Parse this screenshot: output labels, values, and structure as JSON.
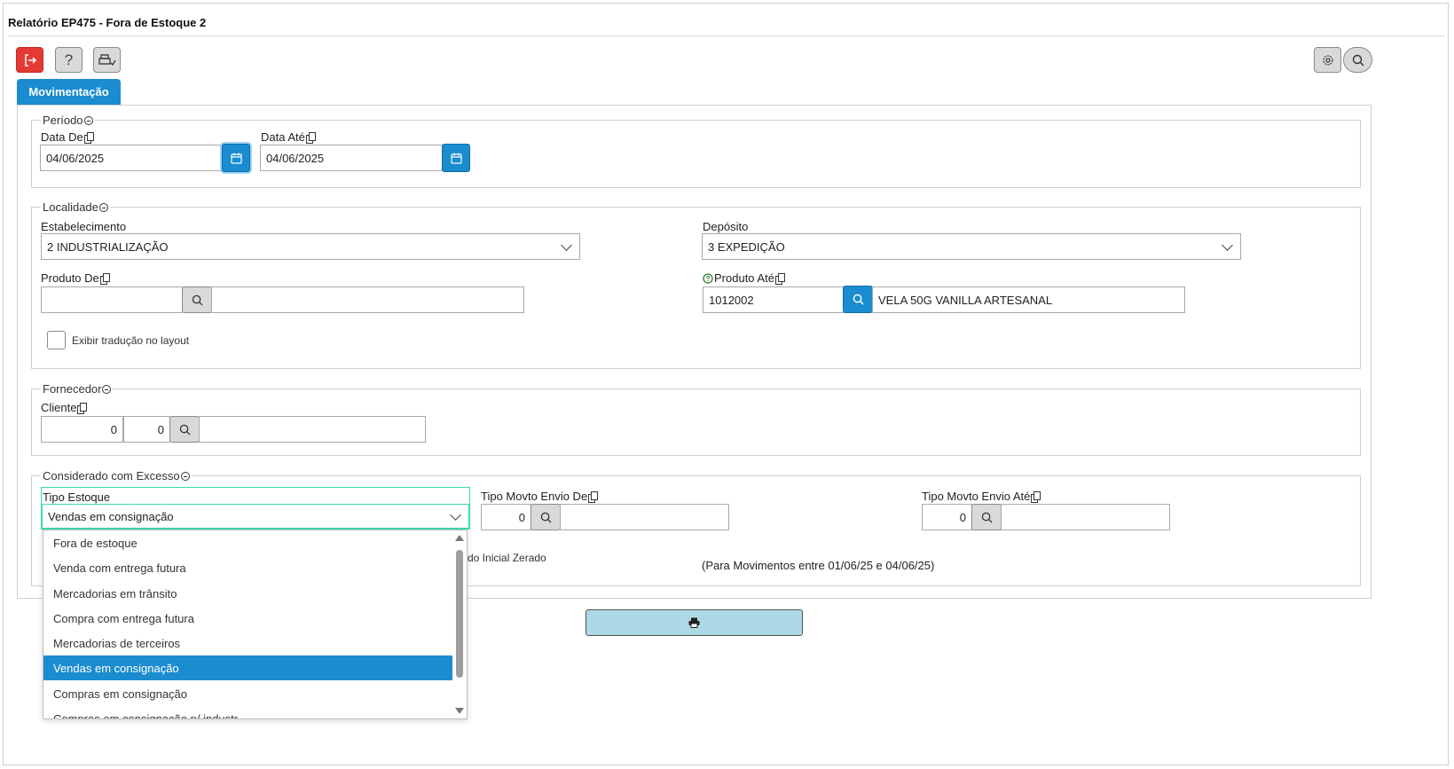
{
  "window": {
    "title": "Relatório EP475 - Fora de Estoque 2"
  },
  "toolbar": {
    "icons": [
      "exit-icon",
      "help-icon",
      "print-setup-icon",
      "gear-icon",
      "search-icon"
    ]
  },
  "tabs": [
    {
      "label": "Movimentação",
      "active": true
    }
  ],
  "periodo": {
    "legend": "Período",
    "data_de": {
      "label": "Data De",
      "value": "04/06/2025"
    },
    "data_ate": {
      "label": "Data Até",
      "value": "04/06/2025"
    }
  },
  "localidade": {
    "legend": "Localidade",
    "estabelecimento": {
      "label": "Estabelecimento",
      "value": "2 INDUSTRIALIZAÇÃO"
    },
    "deposito": {
      "label": "Depósito",
      "value": "3 EXPEDIÇÃO"
    },
    "produto_de": {
      "label": "Produto De",
      "code": "",
      "description": ""
    },
    "produto_ate": {
      "label": "Produto Até",
      "code": "1012002",
      "description": "VELA 50G VANILLA ARTESANAL"
    },
    "exibir_traducao": {
      "label": "Exibir tradução no layout",
      "checked": false
    }
  },
  "fornecedor": {
    "legend": "Fornecedor",
    "cliente": {
      "label": "Cliente",
      "value1": "0",
      "value2": "0",
      "description": ""
    }
  },
  "excesso": {
    "legend": "Considerado com Excesso",
    "tipo_estoque": {
      "label": "Tipo Estoque",
      "value": "Vendas em consignação",
      "options": [
        "Fora de estoque",
        "Venda com entrega futura",
        "Mercadorias em trânsito",
        "Compra com entrega futura",
        "Mercadorias de terceiros",
        "Vendas em consignação",
        "Compras em consignação",
        "Compras em consignação p/ industr"
      ],
      "selected_index": 5
    },
    "tipo_movto_de": {
      "label": "Tipo Movto Envio De",
      "value": "0",
      "description": ""
    },
    "tipo_movto_ate": {
      "label": "Tipo Movto Envio Até",
      "value": "0",
      "description": ""
    },
    "saldo_label_partial": "do Inicial Zerado",
    "movimentos_note": "(Para Movimentos entre 01/06/25 e 04/06/25)"
  },
  "actions": {
    "print_icon": "printer-icon"
  },
  "colors": {
    "primary": "#1a8ccf",
    "danger": "#e53935",
    "print_button": "#add8e6",
    "focus_border": "#3ddbb0"
  }
}
